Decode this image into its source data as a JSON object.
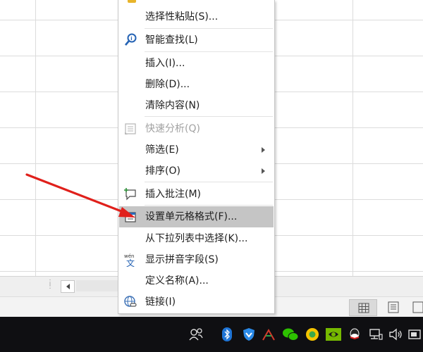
{
  "context_menu": {
    "items": [
      {
        "label": "选择性粘贴(S)...",
        "icon": "paste-special-icon"
      },
      {
        "label": "智能查找(L)",
        "icon": "smart-lookup-icon"
      },
      {
        "label": "插入(I)...",
        "icon": ""
      },
      {
        "label": "删除(D)...",
        "icon": ""
      },
      {
        "label": "清除内容(N)",
        "icon": ""
      },
      {
        "label": "快速分析(Q)",
        "icon": "quick-analysis-icon",
        "disabled": true
      },
      {
        "label": "筛选(E)",
        "icon": "",
        "submenu": true
      },
      {
        "label": "排序(O)",
        "icon": "",
        "submenu": true
      },
      {
        "label": "插入批注(M)",
        "icon": "insert-comment-icon"
      },
      {
        "label": "设置单元格格式(F)...",
        "icon": "format-cells-icon",
        "highlighted": true
      },
      {
        "label": "从下拉列表中选择(K)...",
        "icon": ""
      },
      {
        "label": "显示拼音字段(S)",
        "icon": "phonetic-guide-icon"
      },
      {
        "label": "定义名称(A)...",
        "icon": ""
      },
      {
        "label": "链接(I)",
        "icon": "link-icon"
      }
    ]
  },
  "status_bar": {
    "views": [
      "normal-view",
      "page-layout-view",
      "page-break-view"
    ]
  },
  "tray": {
    "icons": [
      "people-icon",
      "bluetooth-icon",
      "shield-icon",
      "app-icon",
      "wechat-icon",
      "circle-app-icon",
      "nvidia-icon",
      "qq-icon",
      "network-icon",
      "volume-icon",
      "input-method-icon"
    ]
  },
  "colors": {
    "highlight": "#c5c5c5",
    "annotation_arrow": "#e0201b",
    "taskbar": "#0f0f12"
  }
}
